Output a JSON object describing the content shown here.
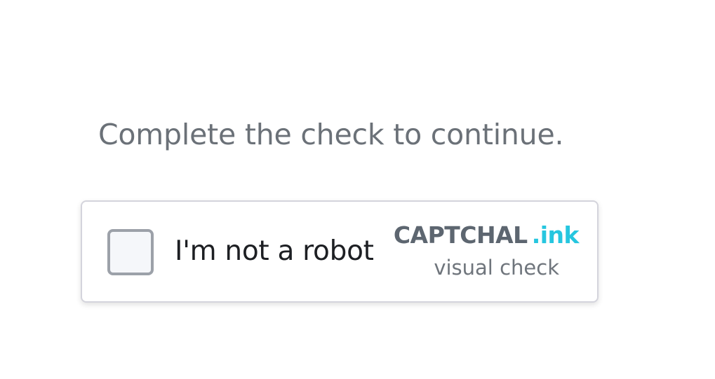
{
  "prompt": {
    "text": "Complete the check to continue."
  },
  "captcha": {
    "checkbox_label": "I'm not a robot",
    "checked": false,
    "brand": {
      "name_main": "CAPTCHAL",
      "name_accent": ".ink",
      "subtitle": "visual check"
    },
    "colors": {
      "accent": "#26c6df",
      "brand_text": "#5d6670",
      "border": "#d4d4dc",
      "checkbox_border": "#9ca1a9"
    }
  }
}
